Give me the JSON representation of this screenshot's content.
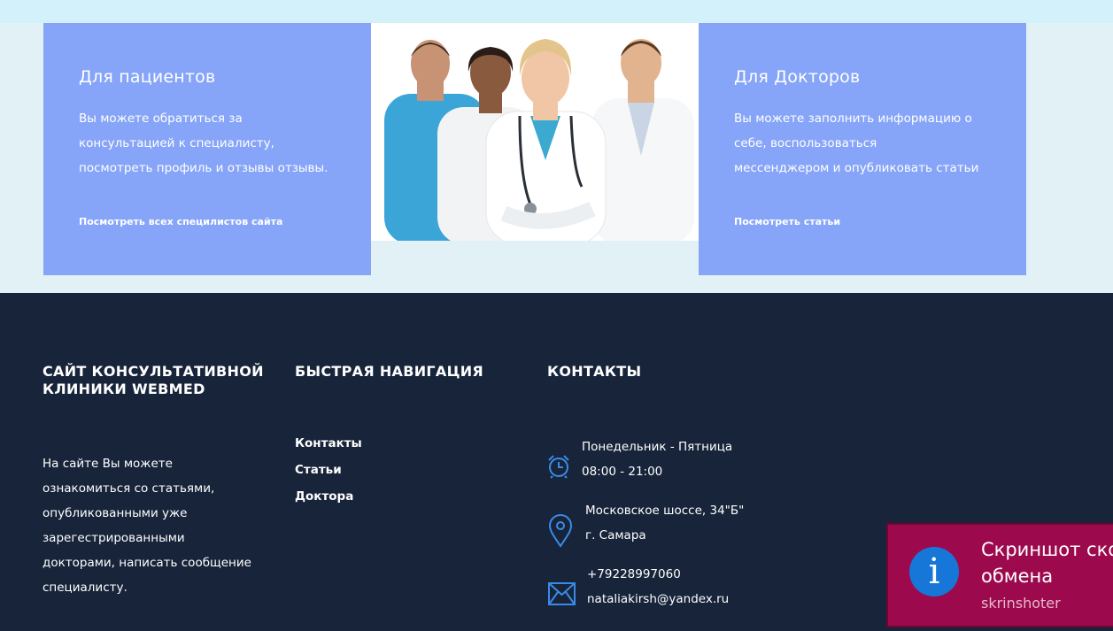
{
  "patients": {
    "title": "Для пациентов",
    "line1": "Вы можете обратиться за",
    "line2": "консультацией к специалисту,",
    "line3": "посмотреть профиль и отзывы отзывы.",
    "link": "Посмотреть всех специлистов сайта"
  },
  "doctors": {
    "title": "Для Докторов",
    "line1": "Вы можете заполнить информацию о",
    "line2": "себе, воспользоваться",
    "line3": "мессенджером и опубликовать статьи",
    "link": "Посмотреть статьи"
  },
  "footer": {
    "about_title_1": "САЙТ КОНСУЛЬТАТИВНОЙ",
    "about_title_2": "КЛИНИКИ WEBMED",
    "about_lines": [
      "На сайте Вы можете",
      "ознакомиться со статьями,",
      "опубликованными уже",
      "зарегестрированными",
      "докторами, написать сообщение",
      "специалисту."
    ],
    "nav_title": "БЫСТРАЯ НАВИГАЦИЯ",
    "nav_links": [
      "Контакты",
      "Статьи",
      "Доктора"
    ],
    "contacts_title": "КОНТАКТЫ",
    "hours_days": "Понедельник - Пятница",
    "hours_time": "08:00 - 21:00",
    "address_street": "Московское шоссе, 34\"Б\"",
    "address_city": "г. Самара",
    "phone": "+79228997060",
    "email": "nataliakirsh@yandex.ru"
  },
  "toast": {
    "line1": "Скриншот скоп",
    "line2": "обмена",
    "app": "skrinshoter"
  },
  "colors": {
    "card": "#87a5f8",
    "footer": "#17243a",
    "icon_blue": "#3a8be8",
    "toast": "#9c0a4d"
  },
  "icons": [
    "alarm-clock-icon",
    "map-pin-icon",
    "envelope-icon",
    "info-icon"
  ]
}
